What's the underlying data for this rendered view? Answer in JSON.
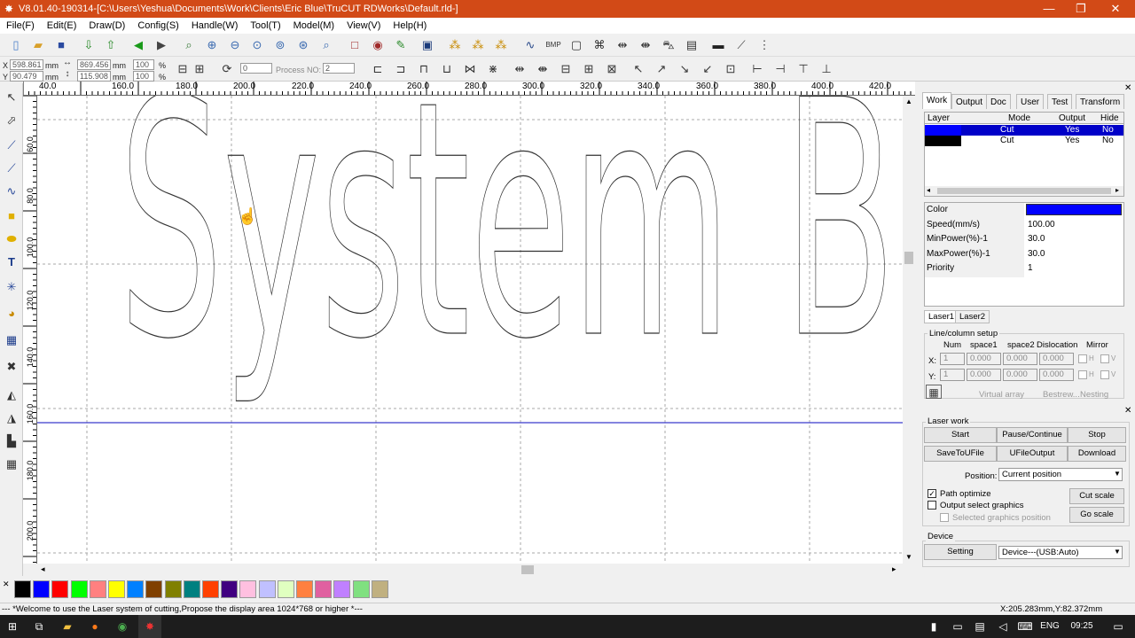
{
  "window": {
    "title": "V8.01.40-190314-[C:\\Users\\Yeshua\\Documents\\Work\\Clients\\Eric Blue\\TruCUT RDWorks\\Default.rld-]",
    "minimize": "—",
    "restore": "❐",
    "close": "✕"
  },
  "menu": [
    "File(F)",
    "Edit(E)",
    "Draw(D)",
    "Config(S)",
    "Handle(W)",
    "Tool(T)",
    "Model(M)",
    "View(V)",
    "Help(H)"
  ],
  "toolbar2": {
    "x_label": "X",
    "x_value": "598.861",
    "y_label": "Y",
    "y_value": "90.479",
    "unit": "mm",
    "w_value": "869.456",
    "h_value": "115.908",
    "w_pct": "100",
    "h_pct": "100",
    "pct": "%",
    "rotate_value": "0",
    "process_label": "Process NO:",
    "process_value": "2"
  },
  "ruler": {
    "h_labels": [
      "40.0",
      "160.0",
      "180.0",
      "200.0",
      "220.0",
      "240.0",
      "260.0",
      "280.0",
      "300.0",
      "320.0",
      "340.0",
      "360.0",
      "380.0",
      "400.0",
      "420.0"
    ],
    "v_labels": [
      "60.0",
      "80.0",
      "100.0",
      "120.0",
      "140.0",
      "160.0",
      "180.0",
      "200.0"
    ]
  },
  "canvas": {
    "text": "System Ba",
    "outline_color": "#333333",
    "line_color": "#3a3acc"
  },
  "tabs": [
    "Work",
    "Output",
    "Doc",
    "User",
    "Test",
    "Transform"
  ],
  "layer_table": {
    "headers": [
      "Layer",
      "Mode",
      "Output",
      "Hide"
    ],
    "rows": [
      {
        "color": "#0000ff",
        "mode": "Cut",
        "output": "Yes",
        "hide": "No",
        "selected": true
      },
      {
        "color": "#000000",
        "mode": "Cut",
        "output": "Yes",
        "hide": "No",
        "selected": false
      }
    ]
  },
  "properties": [
    {
      "label": "Color",
      "value": "",
      "swatch": "#0000ff"
    },
    {
      "label": "Speed(mm/s)",
      "value": "100.00"
    },
    {
      "label": "MinPower(%)-1",
      "value": "30.0"
    },
    {
      "label": "MaxPower(%)-1",
      "value": "30.0"
    },
    {
      "label": "Priority",
      "value": "1"
    }
  ],
  "laser_tabs": [
    "Laser1",
    "Laser2"
  ],
  "array": {
    "title": "Line/column setup",
    "headers": [
      "Num",
      "space1",
      "space2",
      "Dislocation",
      "Mirror"
    ],
    "x_label": "X:",
    "y_label": "Y:",
    "x_values": [
      "1",
      "0.000",
      "0.000",
      "0.000"
    ],
    "y_values": [
      "1",
      "0.000",
      "0.000",
      "0.000"
    ],
    "mirror_h": "H",
    "mirror_v": "V",
    "buttons": [
      "Virtual array",
      "Bestrew...",
      "Nesting"
    ]
  },
  "laser_work": {
    "title": "Laser work",
    "buttons": [
      "Start",
      "Pause/Continue",
      "Stop",
      "SaveToUFile",
      "UFileOutput",
      "Download"
    ],
    "position_label": "Position:",
    "position_value": "Current position",
    "path_optimize": "Path optimize",
    "output_select": "Output select graphics",
    "selected_pos": "Selected graphics position",
    "cut_scale": "Cut scale",
    "go_scale": "Go scale"
  },
  "device": {
    "title": "Device",
    "setting": "Setting",
    "value": "Device---(USB:Auto)"
  },
  "palette": [
    "#000000",
    "#0000ff",
    "#ff0000",
    "#00ff00",
    "#ff8080",
    "#ffff00",
    "#0080ff",
    "#804000",
    "#808000",
    "#008080",
    "#ff4000",
    "#400080",
    "#ffc0e0",
    "#c0c0ff",
    "#e0ffc0",
    "#ff8040",
    "#e060a0",
    "#c080ff",
    "#80e080",
    "#c0b080"
  ],
  "status": {
    "message": "--- *Welcome to use the Laser system of cutting,Propose the display area 1024*768 or higher *---",
    "coords": "X:205.283mm,Y:82.372mm"
  },
  "taskbar": {
    "lang": "ENG",
    "time": "09:25"
  }
}
